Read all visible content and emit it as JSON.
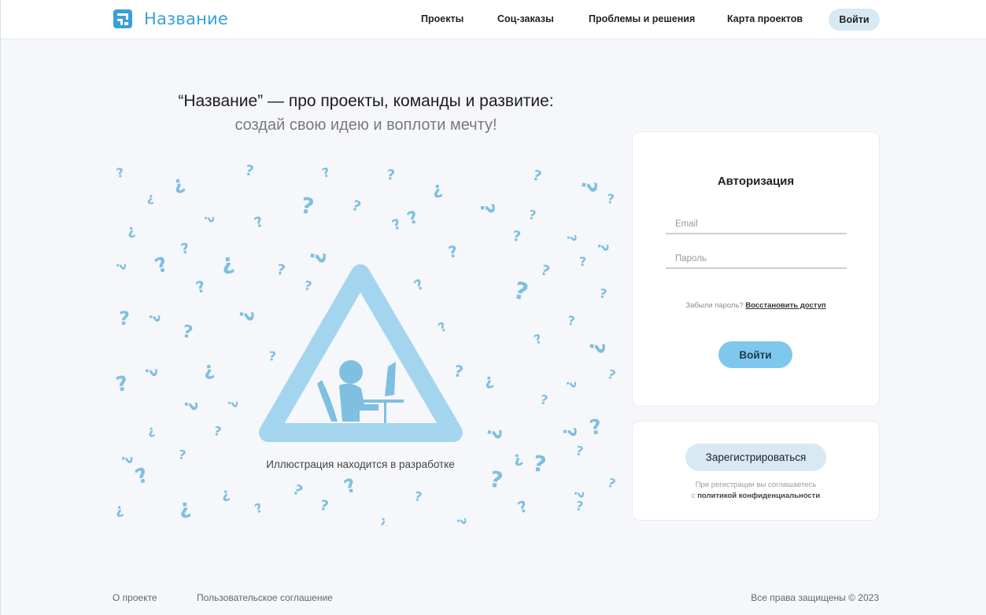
{
  "header": {
    "logo_text": "Название",
    "nav": [
      "Проекты",
      "Соц-заказы",
      "Проблемы и решения",
      "Карта проектов"
    ],
    "login_label": "Войти"
  },
  "hero": {
    "headline": "“Название” — про проекты, команды и развитие:",
    "subline": "создай свою идею и воплоти мечту!",
    "illustration_caption": "Иллюстрация находится в разработке"
  },
  "auth": {
    "title": "Авторизация",
    "email_placeholder": "Email",
    "password_placeholder": "Пароль",
    "forgot_text": "Забыли пароль?",
    "restore_link": "Восстановить доступ",
    "submit_label": "Войти"
  },
  "register": {
    "button_label": "Зарегистрироваться",
    "note_line1": "При регистрации вы соглашаетесь",
    "note_prefix": "с",
    "privacy_link": "политикой конфиденциальности"
  },
  "footer": {
    "about": "О проекте",
    "agreement": "Пользовательское соглашение",
    "copyright": "Все права защищены © 2023"
  },
  "colors": {
    "accent": "#3aa0d8",
    "illustration": "#a3d5ee",
    "button_primary": "#7ec8ed",
    "button_secondary": "#d8e9f3"
  },
  "icons": [
    "logo-icon",
    "question-mark-icon",
    "warning-triangle-icon",
    "person-at-computer-icon"
  ]
}
